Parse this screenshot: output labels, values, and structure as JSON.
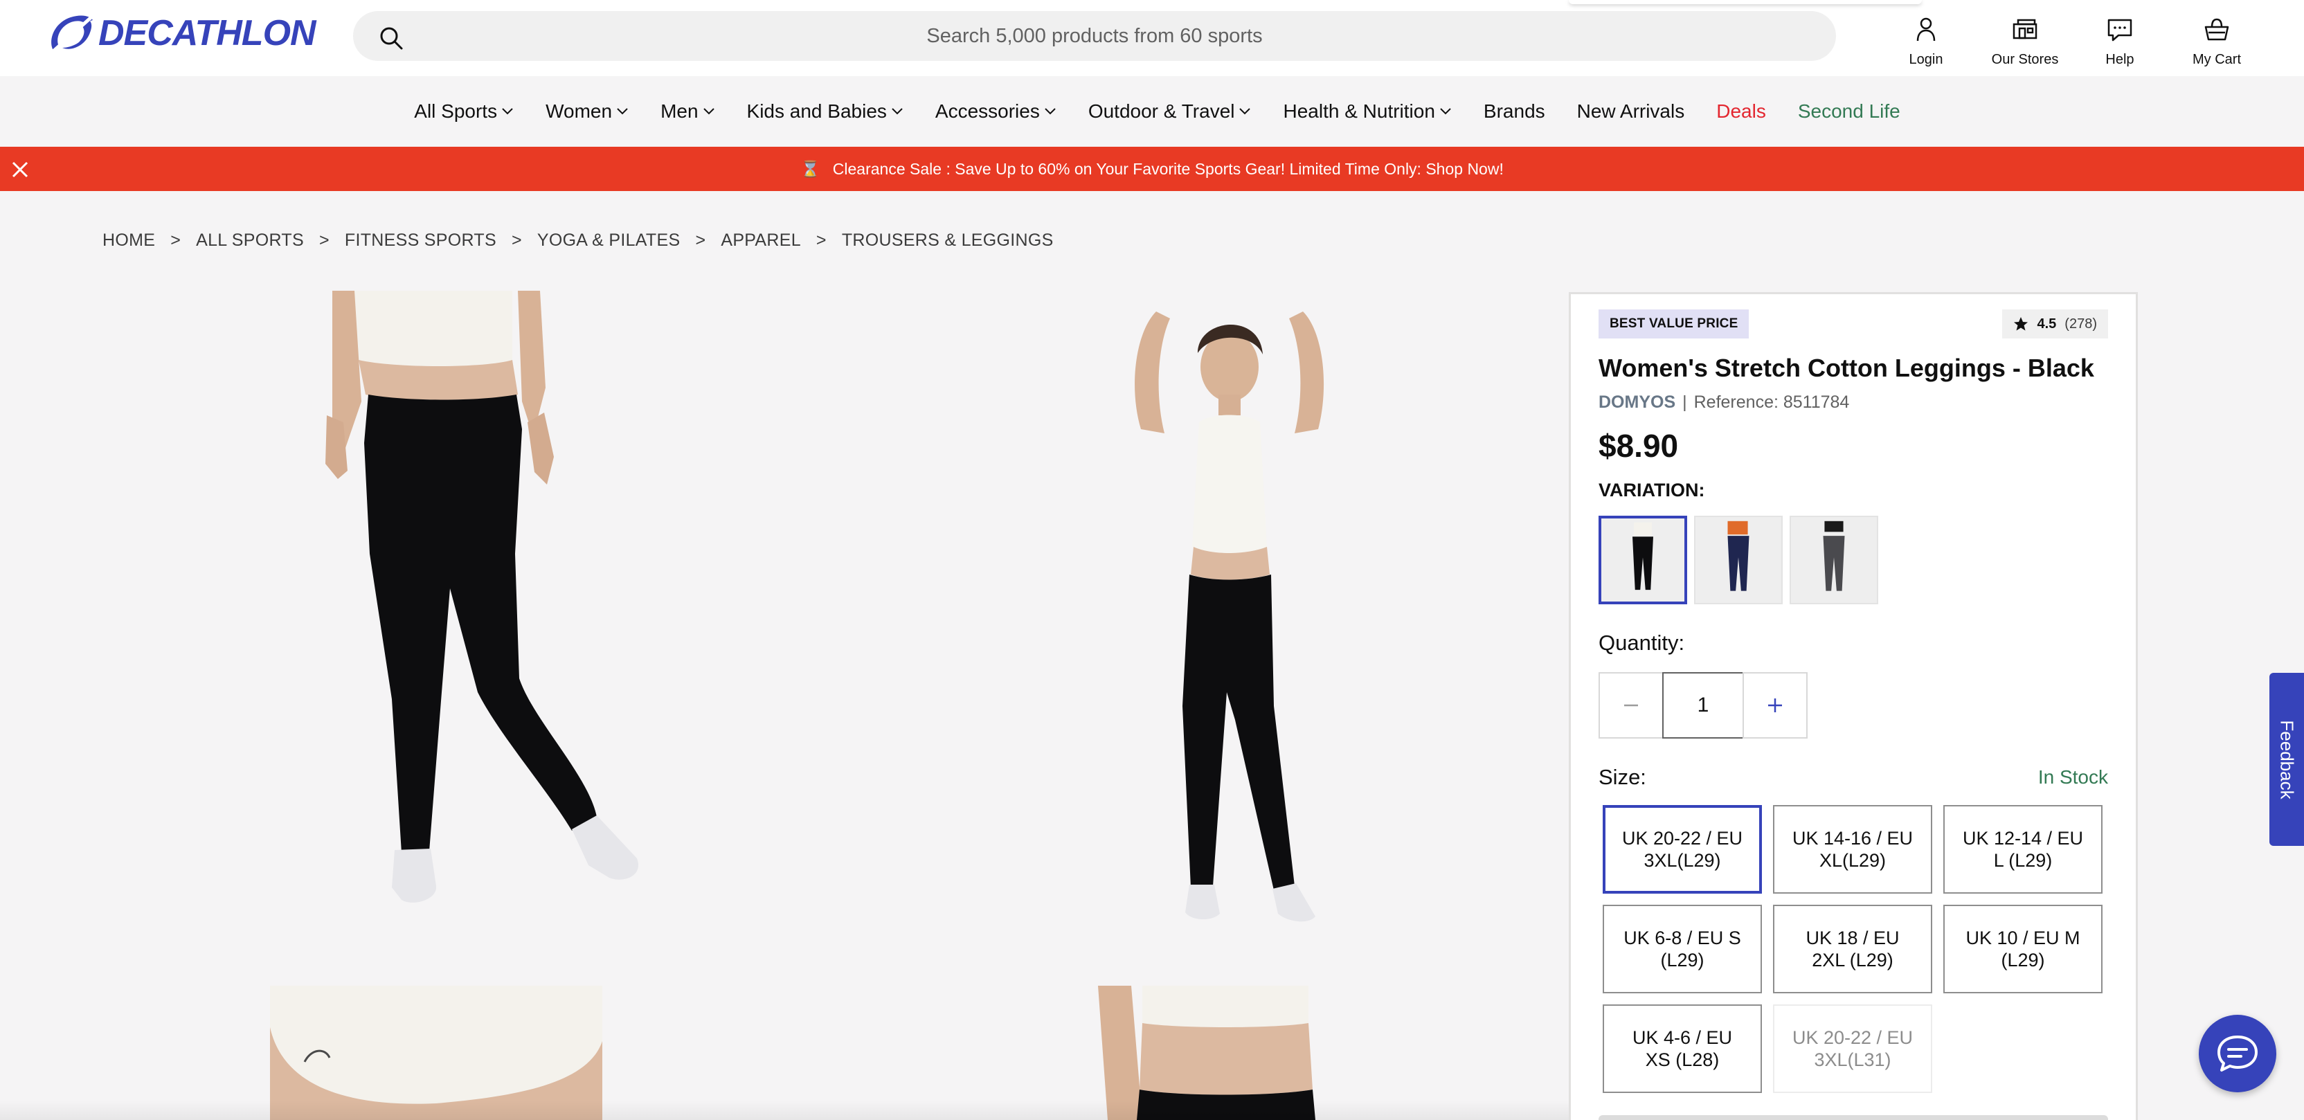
{
  "colors": {
    "brand": "#3643ba",
    "promo": "#e83a24",
    "deals": "#e3262f",
    "second_life": "#337a54",
    "in_stock": "#337a54",
    "background": "#f5f4f5"
  },
  "header": {
    "logo_text": "DECATHLON",
    "search": {
      "placeholder": "Search 5,000 products from 60 sports",
      "icon": "search-icon"
    },
    "actions": [
      {
        "label": "Login",
        "icon": "user-icon"
      },
      {
        "label": "Our Stores",
        "icon": "store-icon"
      },
      {
        "label": "Help",
        "icon": "chat-bubble-icon"
      },
      {
        "label": "My Cart",
        "icon": "basket-icon"
      }
    ]
  },
  "nav": {
    "items": [
      {
        "label": "All Sports",
        "has_dropdown": true
      },
      {
        "label": "Women",
        "has_dropdown": true
      },
      {
        "label": "Men",
        "has_dropdown": true
      },
      {
        "label": "Kids and Babies",
        "has_dropdown": true
      },
      {
        "label": "Accessories",
        "has_dropdown": true
      },
      {
        "label": "Outdoor & Travel",
        "has_dropdown": true
      },
      {
        "label": "Health & Nutrition",
        "has_dropdown": true
      },
      {
        "label": "Brands",
        "has_dropdown": false
      },
      {
        "label": "New Arrivals",
        "has_dropdown": false
      },
      {
        "label": "Deals",
        "has_dropdown": false
      },
      {
        "label": "Second Life",
        "has_dropdown": false
      }
    ]
  },
  "promo": {
    "emoji": "⌛",
    "text": "Clearance Sale : Save Up to 60% on Your Favorite Sports Gear! Limited Time Only: Shop Now!"
  },
  "breadcrumb": {
    "separator": ">",
    "items": [
      "HOME",
      "ALL SPORTS",
      "FITNESS SPORTS",
      "YOGA & PILATES",
      "APPAREL",
      "TROUSERS & LEGGINGS"
    ]
  },
  "product": {
    "badge": "BEST VALUE PRICE",
    "rating": {
      "score": "4.5",
      "count": "(278)"
    },
    "title": "Women's Stretch Cotton Leggings - Black",
    "brand": "DOMYOS",
    "brand_separator": "|",
    "reference": "Reference: 8511784",
    "price": "$8.90",
    "variation_label": "VARIATION:",
    "variants": [
      {
        "color": "black",
        "selected": true
      },
      {
        "color": "navy",
        "selected": false
      },
      {
        "color": "grey",
        "selected": false
      }
    ],
    "quantity_label": "Quantity:",
    "quantity": "1",
    "size_label": "Size:",
    "stock_status": "In Stock",
    "sizes": [
      {
        "label": "UK 20-22 / EU 3XL(L29)",
        "selected": true,
        "available": true
      },
      {
        "label": "UK 14-16 / EU XL(L29)",
        "selected": false,
        "available": true
      },
      {
        "label": "UK 12-14 / EU L (L29)",
        "selected": false,
        "available": true
      },
      {
        "label": "UK 6-8 / EU S (L29)",
        "selected": false,
        "available": true
      },
      {
        "label": "UK 18 / EU 2XL (L29)",
        "selected": false,
        "available": true
      },
      {
        "label": "UK 10 / EU M (L29)",
        "selected": false,
        "available": true
      },
      {
        "label": "UK 4-6 / EU XS (L28)",
        "selected": false,
        "available": true
      },
      {
        "label": "UK 20-22 / EU 3XL(L31)",
        "selected": false,
        "available": false
      }
    ]
  },
  "floating": {
    "feedback": "Feedback",
    "chat_icon": "chat-icon"
  }
}
